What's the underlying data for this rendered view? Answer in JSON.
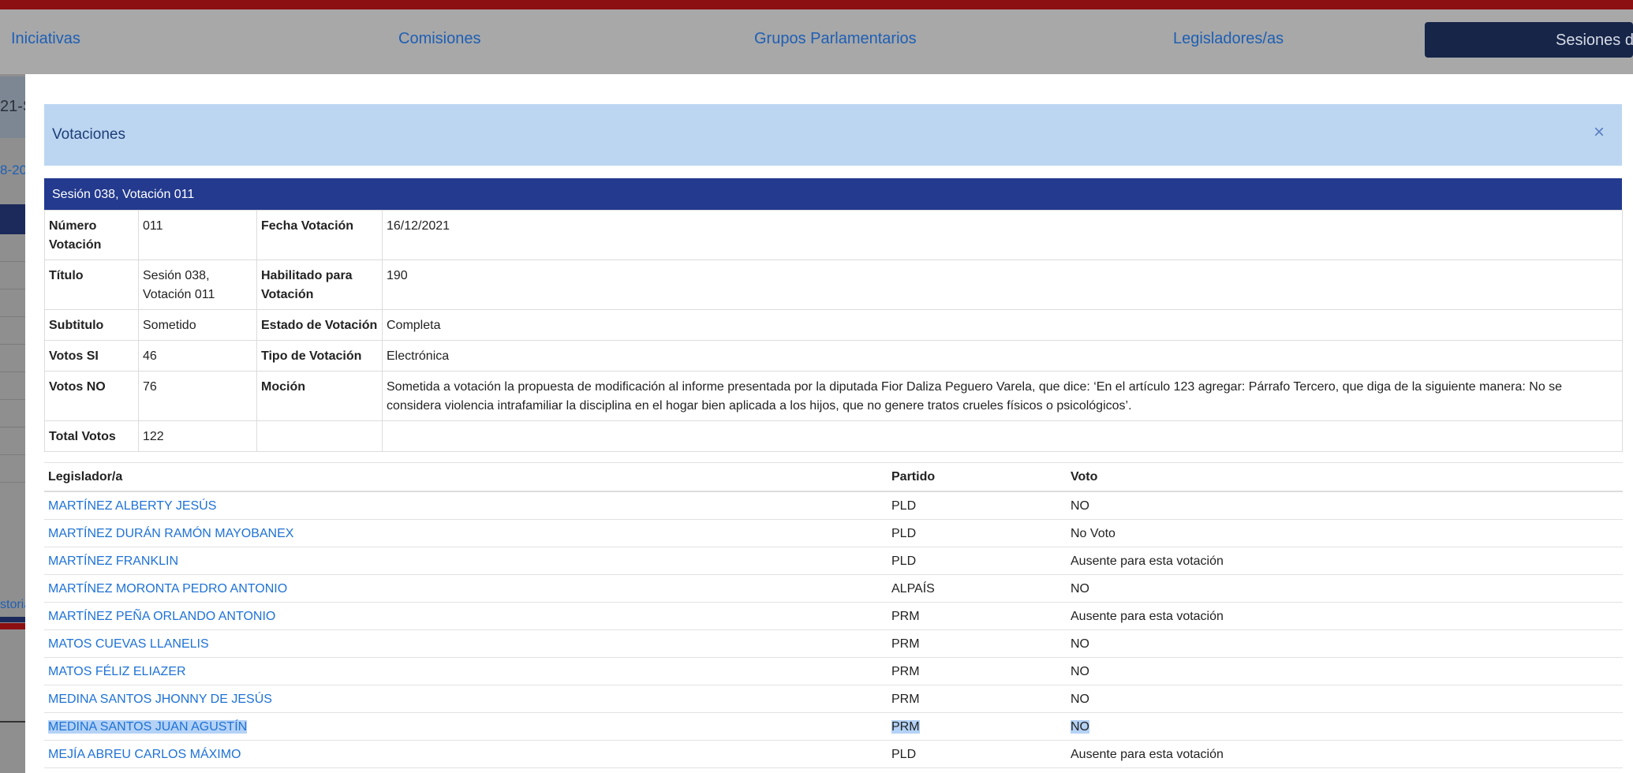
{
  "nav": {
    "items": [
      "Iniciativas",
      "Comisiones",
      "Grupos Parlamentarios",
      "Legisladores/as"
    ],
    "active": "Sesiones d"
  },
  "background": {
    "fragment_1": "21-S",
    "fragment_2": "8-20",
    "fragment_3": "storia"
  },
  "modal": {
    "title": "Votaciones",
    "close_icon": "×",
    "session_heading": "Sesión 038, Votación 011",
    "info": {
      "numero_label": "Número Votación",
      "numero_value": "011",
      "fecha_label": "Fecha Votación",
      "fecha_value": "16/12/2021",
      "titulo_label": "Título",
      "titulo_value": "Sesión 038, Votación 011",
      "habilitado_label": "Habilitado para Votación",
      "habilitado_value": "190",
      "subtitulo_label": "Subtitulo",
      "subtitulo_value": "Sometido",
      "estado_label": "Estado de Votación",
      "estado_value": "Completa",
      "votos_si_label": "Votos SI",
      "votos_si_value": "46",
      "tipo_label": "Tipo de Votación",
      "tipo_value": "Electrónica",
      "votos_no_label": "Votos NO",
      "votos_no_value": "76",
      "mocion_label": "Moción",
      "mocion_value": "Sometida a votación la propuesta de modificación al informe presentada por la diputada Fior Daliza Peguero Varela, que dice: ‘En el artículo 123 agregar: Párrafo Tercero, que diga de la siguiente manera: No se considera violencia intrafamiliar la disciplina en el hogar bien aplicada a los hijos, que no genere tratos crueles físicos o psicológicos’.",
      "total_label": "Total Votos",
      "total_value": "122"
    },
    "votes_table": {
      "headers": [
        "Legislador/a",
        "Partido",
        "Voto"
      ],
      "rows": [
        {
          "name": "MARTÍNEZ ALBERTY JESÚS",
          "party": "PLD",
          "vote": "NO"
        },
        {
          "name": "MARTÍNEZ DURÁN RAMÓN MAYOBANEX",
          "party": "PLD",
          "vote": "No Voto"
        },
        {
          "name": "MARTÍNEZ FRANKLIN",
          "party": "PLD",
          "vote": "Ausente para esta votación"
        },
        {
          "name": "MARTÍNEZ MORONTA PEDRO ANTONIO",
          "party": "ALPAÍS",
          "vote": "NO"
        },
        {
          "name": "MARTÍNEZ PEÑA ORLANDO ANTONIO",
          "party": "PRM",
          "vote": "Ausente para esta votación"
        },
        {
          "name": "MATOS CUEVAS LLANELIS",
          "party": "PRM",
          "vote": "NO"
        },
        {
          "name": "MATOS FÉLIZ ELIAZER",
          "party": "PRM",
          "vote": "NO"
        },
        {
          "name": "MEDINA SANTOS JHONNY DE JESÚS",
          "party": "PRM",
          "vote": "NO"
        },
        {
          "name": "MEDINA SANTOS JUAN AGUSTÍN",
          "party": "PRM",
          "vote": "NO"
        },
        {
          "name": "MEJÍA ABREU CARLOS MÁXIMO",
          "party": "PLD",
          "vote": "Ausente para esta votación"
        }
      ]
    }
  }
}
